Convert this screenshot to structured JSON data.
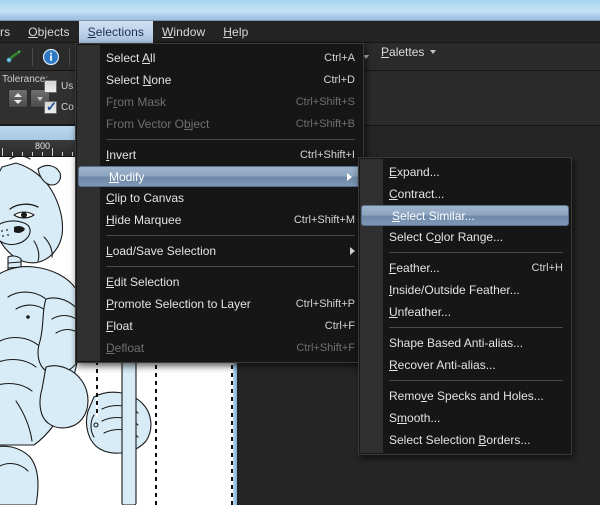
{
  "menubar": {
    "items": [
      {
        "label": "rs",
        "mnemonic": "",
        "active": false,
        "clipped": true
      },
      {
        "label": "Objects",
        "mnemonic": "O",
        "active": false
      },
      {
        "label": "Selections",
        "mnemonic": "S",
        "active": true
      },
      {
        "label": "Window",
        "mnemonic": "W",
        "active": false
      },
      {
        "label": "Help",
        "mnemonic": "H",
        "active": false
      }
    ]
  },
  "toolbar": {
    "palettes_label": "Palettes",
    "icons": [
      "paint-drip-icon",
      "info-icon",
      "zoom-out-icon"
    ]
  },
  "options": {
    "tolerance_label": "Tolerance:",
    "checkbox_use_label": "Us",
    "checkbox_use_checked": false,
    "checkbox_contiguous_label": "Co",
    "checkbox_contiguous_checked": true
  },
  "document": {
    "ruler_label": "800"
  },
  "menu_selections": {
    "title": "Selections",
    "items": [
      {
        "label": "Select All",
        "mnemonic": "A",
        "accel": "Ctrl+A",
        "state": "normal"
      },
      {
        "label": "Select None",
        "mnemonic": "N",
        "accel": "Ctrl+D",
        "state": "normal"
      },
      {
        "label": "From Mask",
        "mnemonic": "r",
        "accel": "Ctrl+Shift+S",
        "state": "disabled"
      },
      {
        "label": "From Vector Object",
        "mnemonic": "b",
        "accel": "Ctrl+Shift+B",
        "state": "disabled"
      },
      {
        "type": "separator"
      },
      {
        "label": "Invert",
        "mnemonic": "I",
        "accel": "Ctrl+Shift+I",
        "state": "normal"
      },
      {
        "label": "Modify",
        "mnemonic": "M",
        "accel": "",
        "state": "highlighted",
        "submenu": true
      },
      {
        "label": "Clip to Canvas",
        "mnemonic": "C",
        "accel": "",
        "state": "normal"
      },
      {
        "label": "Hide Marquee",
        "mnemonic": "H",
        "accel": "Ctrl+Shift+M",
        "state": "normal"
      },
      {
        "type": "separator"
      },
      {
        "label": "Load/Save Selection",
        "mnemonic": "L",
        "accel": "",
        "state": "normal",
        "submenu": true
      },
      {
        "type": "separator"
      },
      {
        "label": "Edit Selection",
        "mnemonic": "E",
        "accel": "",
        "state": "normal"
      },
      {
        "label": "Promote Selection to Layer",
        "mnemonic": "P",
        "accel": "Ctrl+Shift+P",
        "state": "normal"
      },
      {
        "label": "Float",
        "mnemonic": "F",
        "accel": "Ctrl+F",
        "state": "normal"
      },
      {
        "label": "Defloat",
        "mnemonic": "D",
        "accel": "Ctrl+Shift+F",
        "state": "disabled"
      }
    ]
  },
  "menu_modify": {
    "title": "Modify",
    "items": [
      {
        "label": "Expand...",
        "mnemonic": "E",
        "accel": "",
        "state": "normal"
      },
      {
        "label": "Contract...",
        "mnemonic": "C",
        "accel": "",
        "state": "normal"
      },
      {
        "label": "Select Similar...",
        "mnemonic": "S",
        "accel": "",
        "state": "highlighted"
      },
      {
        "label": "Select Color Range...",
        "mnemonic": "o",
        "accel": "",
        "state": "normal"
      },
      {
        "type": "separator"
      },
      {
        "label": "Feather...",
        "mnemonic": "F",
        "accel": "Ctrl+H",
        "state": "normal"
      },
      {
        "label": "Inside/Outside Feather...",
        "mnemonic": "I",
        "accel": "",
        "state": "normal"
      },
      {
        "label": "Unfeather...",
        "mnemonic": "U",
        "accel": "",
        "state": "normal"
      },
      {
        "type": "separator"
      },
      {
        "label": "Shape Based Anti-alias...",
        "mnemonic": "g",
        "accel": "",
        "state": "normal"
      },
      {
        "label": "Recover Anti-alias...",
        "mnemonic": "R",
        "accel": "",
        "state": "normal"
      },
      {
        "type": "separator"
      },
      {
        "label": "Remove Specks and Holes...",
        "mnemonic": "v",
        "accel": "",
        "state": "normal"
      },
      {
        "label": "Smooth...",
        "mnemonic": "m",
        "accel": "",
        "state": "normal"
      },
      {
        "label": "Select Selection Borders...",
        "mnemonic": "B",
        "accel": "",
        "state": "normal"
      }
    ]
  },
  "colors": {
    "menu_bg": "#161616",
    "menu_gutter": "#303030",
    "highlight": "#8da6c2",
    "menubar_active_bg": "#bed2ea",
    "aero_blue": "#b6dcf4",
    "selection_fill": "#d8ecf7"
  }
}
